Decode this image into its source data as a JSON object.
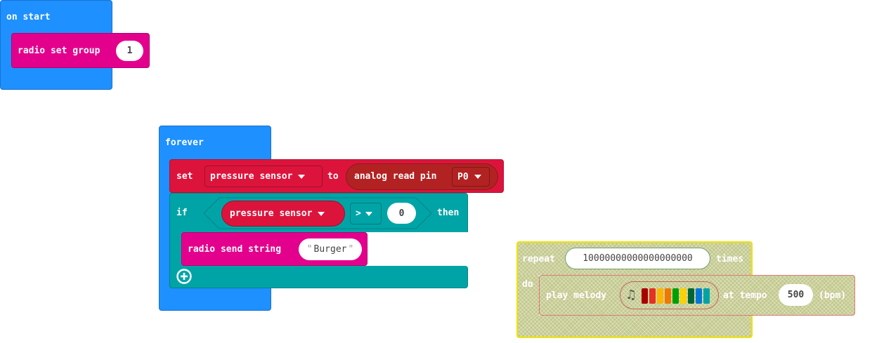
{
  "colors": {
    "basic_blue": "#1e90ff",
    "radio_pink": "#e3008c",
    "variable_red": "#dc143c",
    "pins_red": "#b22222",
    "logic_teal": "#00a4a6",
    "disabled_olive": "#c2c88c",
    "disabled_outline": "#f0e300"
  },
  "on_start": {
    "label": "on start",
    "radio_set_group": {
      "label": "radio set group",
      "value": "1"
    }
  },
  "forever": {
    "label": "forever",
    "set_block": {
      "label": "set",
      "variable": "pressure sensor",
      "to_label": "to",
      "analog_read": {
        "label": "analog read pin",
        "pin": "P0"
      }
    },
    "if_block": {
      "if_label": "if",
      "left_variable": "pressure sensor",
      "operator": ">",
      "right_value": "0",
      "then_label": "then",
      "radio_send": {
        "label": "radio send string",
        "value": "Burger"
      },
      "add_icon": "plus-circle-icon"
    }
  },
  "repeat_block": {
    "repeat_label": "repeat",
    "count": "10000000000000000000",
    "times_label": "times",
    "do_label": "do",
    "play_melody": {
      "label": "play melody",
      "note_icon": "music-note-icon",
      "melody_colors": [
        "#a80000",
        "#e63022",
        "#ffb400",
        "#f07800",
        "#00a000",
        "#ffd000",
        "#006633",
        "#0078d7",
        "#00a4a6"
      ],
      "tempo_label": "at tempo",
      "tempo_value": "500",
      "bpm_label": "(bpm)"
    }
  }
}
